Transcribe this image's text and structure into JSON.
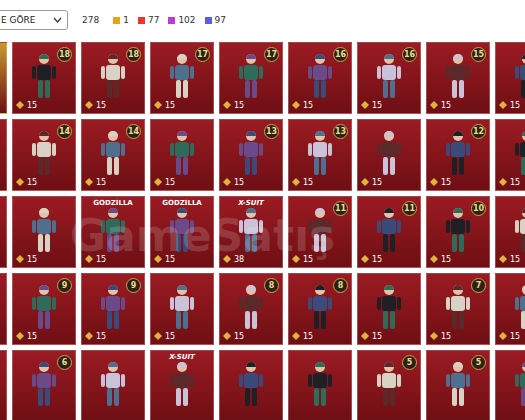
{
  "sort_dropdown": {
    "value": "E GÖRE"
  },
  "total": "278",
  "rarity_counts": [
    {
      "count": "1",
      "color": "#e8a31c"
    },
    {
      "count": "77",
      "color": "#e8372c"
    },
    {
      "count": "102",
      "color": "#c23ad6"
    },
    {
      "count": "97",
      "color": "#5a5ee0"
    }
  ],
  "watermark": "GameSatış",
  "rows": [
    [
      {
        "color": "#c79a2e",
        "badge": null,
        "price": null,
        "tag": null
      },
      {
        "color": "#9b1b22",
        "badge": "18",
        "price": "15",
        "tag": null
      },
      {
        "color": "#9b1b22",
        "badge": "18",
        "price": "15",
        "tag": null
      },
      {
        "color": "#9b1b22",
        "badge": "17",
        "price": "15",
        "tag": null
      },
      {
        "color": "#9b1b22",
        "badge": "17",
        "price": "15",
        "tag": null
      },
      {
        "color": "#9b1b22",
        "badge": "16",
        "price": "15",
        "tag": null
      },
      {
        "color": "#9b1b22",
        "badge": "16",
        "price": "15",
        "tag": null
      },
      {
        "color": "#9b1b22",
        "badge": "15",
        "price": "15",
        "tag": null
      },
      {
        "color": "#9b1b22",
        "badge": null,
        "price": "15",
        "tag": null
      }
    ],
    [
      {
        "color": "#9b1b22",
        "badge": null,
        "price": null,
        "tag": null
      },
      {
        "color": "#9b1b22",
        "badge": "14",
        "price": "15",
        "tag": null
      },
      {
        "color": "#9b1b22",
        "badge": "14",
        "price": "15",
        "tag": null
      },
      {
        "color": "#9b1b22",
        "badge": null,
        "price": "15",
        "tag": null
      },
      {
        "color": "#9b1b22",
        "badge": "13",
        "price": "15",
        "tag": null
      },
      {
        "color": "#9b1b22",
        "badge": "13",
        "price": "15",
        "tag": null
      },
      {
        "color": "#9b1b22",
        "badge": null,
        "price": "15",
        "tag": null
      },
      {
        "color": "#9b1b22",
        "badge": "12",
        "price": "15",
        "tag": null
      },
      {
        "color": "#9b1b22",
        "badge": null,
        "price": "15",
        "tag": null
      }
    ],
    [
      {
        "color": "#9b1b22",
        "badge": null,
        "price": null,
        "tag": null
      },
      {
        "color": "#9b1b22",
        "badge": null,
        "price": "15",
        "tag": null
      },
      {
        "color": "#9b1b22",
        "badge": null,
        "price": "15",
        "tag": "GODZILLA"
      },
      {
        "color": "#9b1b22",
        "badge": null,
        "price": "15",
        "tag": "GODZILLA"
      },
      {
        "color": "#9b1b22",
        "badge": null,
        "price": "38",
        "tag": "X-SUIT"
      },
      {
        "color": "#9b1b22",
        "badge": "11",
        "price": "15",
        "tag": null
      },
      {
        "color": "#9b1b22",
        "badge": "11",
        "price": "15",
        "tag": null
      },
      {
        "color": "#9b1b22",
        "badge": "10",
        "price": "15",
        "tag": null
      },
      {
        "color": "#9b1b22",
        "badge": null,
        "price": "15",
        "tag": null
      }
    ],
    [
      {
        "color": "#9b1b22",
        "badge": null,
        "price": null,
        "tag": null
      },
      {
        "color": "#9b1b22",
        "badge": "9",
        "price": "15",
        "tag": null
      },
      {
        "color": "#9b1b22",
        "badge": "9",
        "price": "15",
        "tag": null
      },
      {
        "color": "#9b1b22",
        "badge": null,
        "price": "15",
        "tag": null
      },
      {
        "color": "#9b1b22",
        "badge": "8",
        "price": "15",
        "tag": null
      },
      {
        "color": "#9b1b22",
        "badge": "8",
        "price": "15",
        "tag": null
      },
      {
        "color": "#9b1b22",
        "badge": null,
        "price": "15",
        "tag": null
      },
      {
        "color": "#9b1b22",
        "badge": "7",
        "price": "15",
        "tag": null
      },
      {
        "color": "#9b1b22",
        "badge": null,
        "price": "15",
        "tag": null
      }
    ],
    [
      {
        "color": "#9b1b22",
        "badge": null,
        "price": null,
        "tag": null
      },
      {
        "color": "#9b1b22",
        "badge": "6",
        "price": null,
        "tag": null
      },
      {
        "color": "#9b1b22",
        "badge": null,
        "price": null,
        "tag": null
      },
      {
        "color": "#9b1b22",
        "badge": null,
        "price": null,
        "tag": "X-SUIT"
      },
      {
        "color": "#9b1b22",
        "badge": null,
        "price": null,
        "tag": null
      },
      {
        "color": "#9b1b22",
        "badge": null,
        "price": null,
        "tag": null
      },
      {
        "color": "#9b1b22",
        "badge": "5",
        "price": null,
        "tag": null
      },
      {
        "color": "#9b1b22",
        "badge": "5",
        "price": null,
        "tag": null
      },
      {
        "color": "#9b1b22",
        "badge": null,
        "price": null,
        "tag": null
      }
    ]
  ]
}
